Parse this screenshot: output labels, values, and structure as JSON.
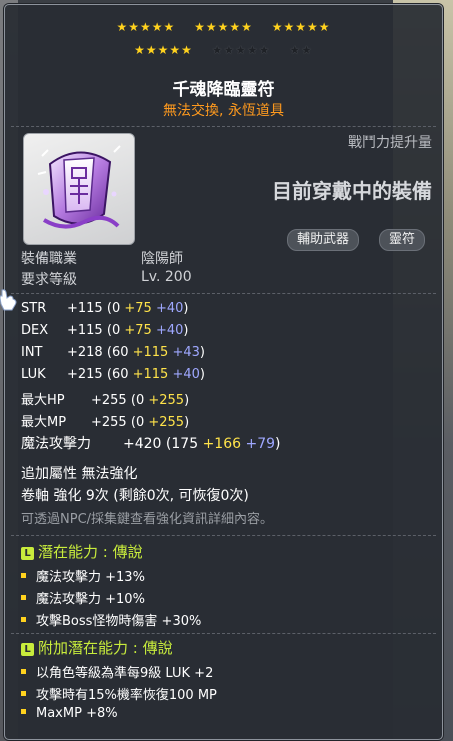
{
  "stars": {
    "filled": 20,
    "total": 22
  },
  "item": {
    "name": "千魂降臨靈符",
    "subtitle": "無法交換, 永恆道具"
  },
  "power": {
    "label": "戰鬥力提升量",
    "value": "目前穿戴中的裝備"
  },
  "tags": [
    "輔助武器",
    "靈符"
  ],
  "requirements": [
    {
      "label": "裝備職業",
      "value": "陰陽師"
    },
    {
      "label": "要求等級",
      "value": "Lv. 200"
    }
  ],
  "stats": [
    {
      "name": "STR",
      "total": "+115",
      "base": "0",
      "bonus": "+75",
      "extra": "+40"
    },
    {
      "name": "DEX",
      "total": "+115",
      "base": "0",
      "bonus": "+75",
      "extra": "+40"
    },
    {
      "name": "INT",
      "total": "+218",
      "base": "60",
      "bonus": "+115",
      "extra": "+43"
    },
    {
      "name": "LUK",
      "total": "+215",
      "base": "60",
      "bonus": "+115",
      "extra": "+40"
    },
    {
      "name": "最大HP",
      "total": "+255",
      "base": "0",
      "bonus": "+255",
      "extra": ""
    },
    {
      "name": "最大MP",
      "total": "+255",
      "base": "0",
      "bonus": "+255",
      "extra": ""
    },
    {
      "name": "魔法攻擊力",
      "total": "+420",
      "base": "175",
      "bonus": "+166",
      "extra": "+79"
    }
  ],
  "extra": {
    "bonus_attr": "追加屬性 無法強化",
    "scroll": "卷軸 強化 9次 (剩餘0次, 可恢復0次)",
    "hint": "可透過NPC/採集鍵查看強化資訊詳細內容。"
  },
  "potential": {
    "header": "潛在能力 : 傳說",
    "badge": "L",
    "lines": [
      "魔法攻擊力 +13%",
      "魔法攻擊力 +10%",
      "攻擊Boss怪物時傷害 +30%"
    ]
  },
  "additional_potential": {
    "header": "附加潛在能力 : 傳說",
    "badge": "L",
    "lines": [
      "以角色等級為準每9級 LUK +2",
      "攻擊時有15%機率恢復100 MP",
      "MaxMP +8%"
    ]
  },
  "colors": {
    "star": "#ffd21e",
    "subtitle": "#ff9a1e",
    "bonus_yellow": "#ffe34a",
    "extra_blue": "#9fa8ff",
    "legend_green": "#c8ec3c"
  }
}
